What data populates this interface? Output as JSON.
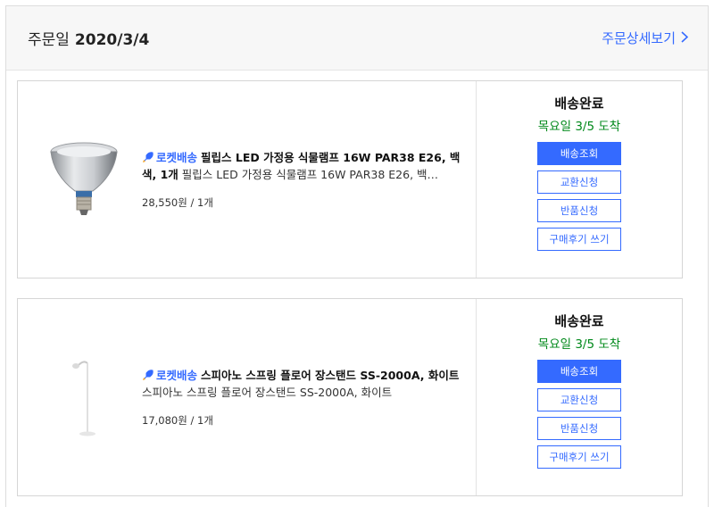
{
  "order": {
    "date_label": "주문일",
    "date_value": "2020/3/4",
    "detail_link": "주문상세보기",
    "colors": {
      "accent": "#346aff",
      "arrival": "#00891a"
    }
  },
  "items": [
    {
      "rocket_label": "로켓배송",
      "name_bold": "필립스 LED 가정용 식물램프 16W PAR38 E26, 백색, 1개",
      "name_sub": "필립스 LED 가정용 식물램프 16W PAR38 E26, 백…",
      "price": "28,550원 / 1개",
      "status": "배송완료",
      "arrival": "목요일 3/5 도착",
      "buttons": {
        "track": "배송조회",
        "exchange": "교환신청",
        "return": "반품신청",
        "review": "구매후기 쓰기"
      }
    },
    {
      "rocket_label": "로켓배송",
      "name_bold": "스피아노 스프링 플로어 장스탠드 SS-2000A, 화이트",
      "name_sub": "스피아노 스프링 플로어 장스탠드 SS-2000A, 화이트",
      "price": "17,080원 / 1개",
      "status": "배송완료",
      "arrival": "목요일 3/5 도착",
      "buttons": {
        "track": "배송조회",
        "exchange": "교환신청",
        "return": "반품신청",
        "review": "구매후기 쓰기"
      }
    }
  ]
}
